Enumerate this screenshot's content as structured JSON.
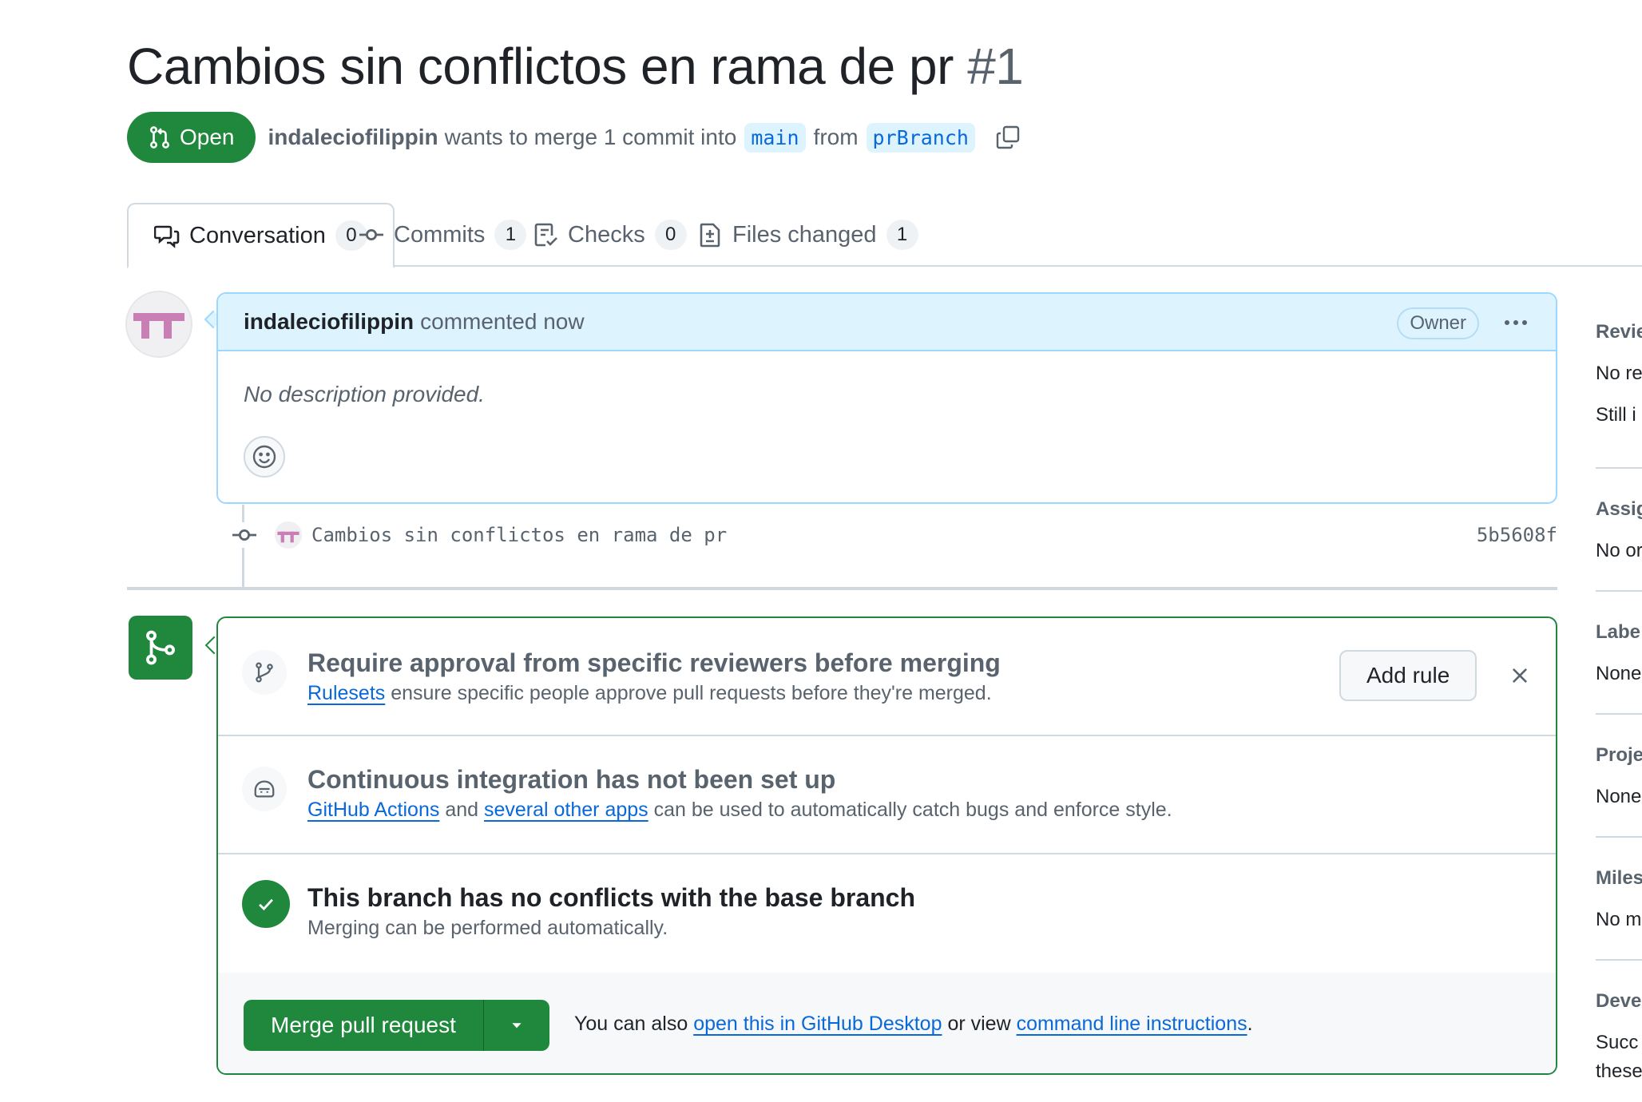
{
  "header": {
    "title": "Cambios sin conflictos en rama de pr",
    "number": "#1",
    "state": "Open",
    "author": "indaleciofilippin",
    "action_text": "wants to merge 1 commit into",
    "base_branch": "main",
    "from_text": "from",
    "head_branch": "prBranch"
  },
  "tabs": [
    {
      "label": "Conversation",
      "count": "0"
    },
    {
      "label": "Commits",
      "count": "1"
    },
    {
      "label": "Checks",
      "count": "0"
    },
    {
      "label": "Files changed",
      "count": "1"
    }
  ],
  "comment": {
    "author": "indaleciofilippin",
    "time": "commented now",
    "badge": "Owner",
    "body": "No description provided."
  },
  "commit": {
    "message": "Cambios sin conflictos en rama de pr",
    "sha": "5b5608f"
  },
  "merge": {
    "rules": {
      "title": "Require approval from specific reviewers before merging",
      "link": "Rulesets",
      "desc": "ensure specific people approve pull requests before they're merged.",
      "button": "Add rule"
    },
    "ci": {
      "title": "Continuous integration has not been set up",
      "link1": "GitHub Actions",
      "and": "and",
      "link2": "several other apps",
      "desc": "can be used to automatically catch bugs and enforce style."
    },
    "conflicts": {
      "title": "This branch has no conflicts with the base branch",
      "desc": "Merging can be performed automatically."
    },
    "footer": {
      "merge_button": "Merge pull request",
      "prefix": "You can also",
      "link1": "open this in GitHub Desktop",
      "middle": "or view",
      "link2": "command line instructions",
      "suffix": "."
    }
  },
  "sidebar": [
    {
      "heading": "Revie",
      "lines": [
        "No re",
        "Still i"
      ]
    },
    {
      "heading": "Assig",
      "lines": [
        "No or"
      ]
    },
    {
      "heading": "Labe",
      "lines": [
        "None"
      ]
    },
    {
      "heading": "Proje",
      "lines": [
        "None"
      ]
    },
    {
      "heading": "Miles",
      "lines": [
        "No m"
      ]
    },
    {
      "heading": "Deve",
      "lines": [
        "Succ",
        "these"
      ]
    }
  ],
  "colors": {
    "accent_green": "#1f883d",
    "link_blue": "#0969da",
    "comment_bg": "#ddf4ff",
    "avatar_pink": "#c97fb6"
  }
}
